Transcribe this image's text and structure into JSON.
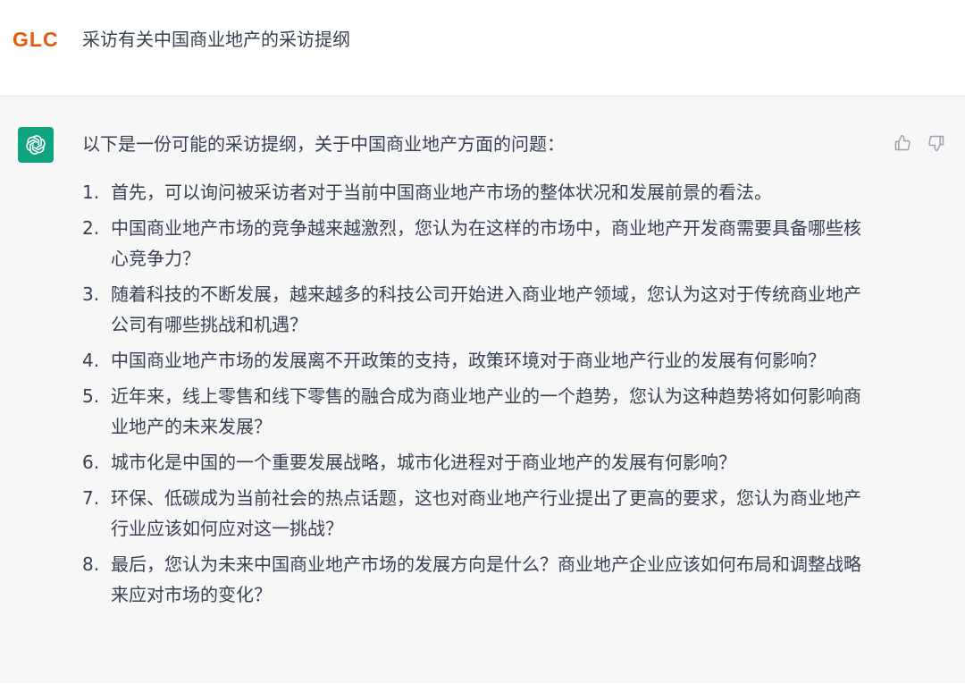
{
  "user": {
    "avatar_label": "GLC",
    "message": "采访有关中国商业地产的采访提纲"
  },
  "assistant": {
    "avatar_icon": "openai-logo-icon",
    "intro": "以下是一份可能的采访提纲，关于中国商业地产方面的问题：",
    "points": [
      {
        "num": "1.",
        "text": "首先，可以询问被采访者对于当前中国商业地产市场的整体状况和发展前景的看法。"
      },
      {
        "num": "2.",
        "text": "中国商业地产市场的竞争越来越激烈，您认为在这样的市场中，商业地产开发商需要具备哪些核心竞争力？"
      },
      {
        "num": "3.",
        "text": "随着科技的不断发展，越来越多的科技公司开始进入商业地产领域，您认为这对于传统商业地产公司有哪些挑战和机遇？"
      },
      {
        "num": "4.",
        "text": "中国商业地产市场的发展离不开政策的支持，政策环境对于商业地产行业的发展有何影响？"
      },
      {
        "num": "5.",
        "text": "近年来，线上零售和线下零售的融合成为商业地产业的一个趋势，您认为这种趋势将如何影响商业地产的未来发展？"
      },
      {
        "num": "6.",
        "text": "城市化是中国的一个重要发展战略，城市化进程对于商业地产的发展有何影响？"
      },
      {
        "num": "7.",
        "text": "环保、低碳成为当前社会的热点话题，这也对商业地产行业提出了更高的要求，您认为商业地产行业应该如何应对这一挑战？"
      },
      {
        "num": "8.",
        "text": "最后，您认为未来中国商业地产市场的发展方向是什么？商业地产企业应该如何布局和调整战略来应对市场的变化？"
      }
    ],
    "feedback": {
      "up_icon": "thumbs-up-icon",
      "down_icon": "thumbs-down-icon"
    }
  },
  "colors": {
    "user_avatar": "#e8590c",
    "bot_avatar_bg": "#10a37f",
    "assistant_bg": "#f7f7f8",
    "text": "#374151",
    "icon": "#9ca3af"
  }
}
